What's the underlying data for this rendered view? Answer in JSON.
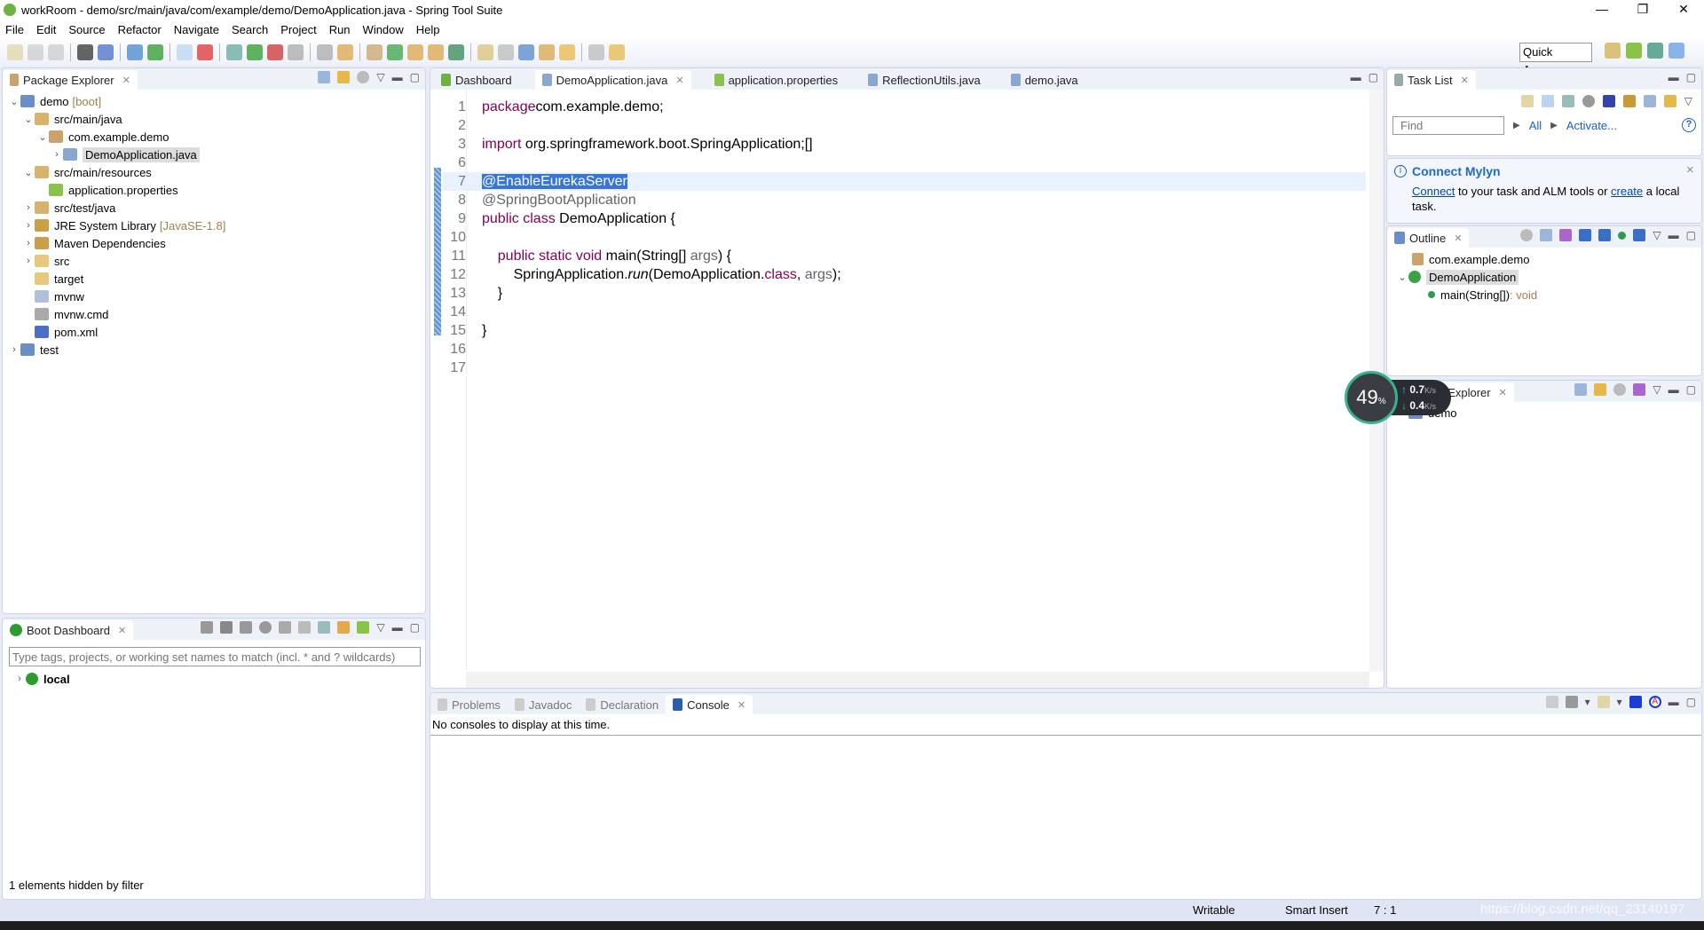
{
  "window": {
    "title": "workRoom - demo/src/main/java/com/example/demo/DemoApplication.java - Spring Tool Suite",
    "min": "—",
    "max": "❐",
    "close": "✕"
  },
  "menu": [
    "File",
    "Edit",
    "Source",
    "Refactor",
    "Navigate",
    "Search",
    "Project",
    "Run",
    "Window",
    "Help"
  ],
  "toolbar": {
    "icons": [
      "new-icon",
      "save-icon",
      "save-all-icon",
      "user-icon",
      "terminal-icon",
      "skip-breakpoints-icon",
      "boot-icon",
      "toggle-icon",
      "spring-relaunch-icon",
      "debug-icon",
      "run-icon",
      "external-tools-icon",
      "stop-icon",
      "open-task-icon",
      "new-java-project-icon",
      "new-package-icon",
      "new-class-icon",
      "open-type-icon",
      "open-folder-icon",
      "search-icon",
      "annotation-icon",
      "highlight-icon",
      "show-whitespace-icon",
      "next-annotation-icon",
      "prev-annotation-icon",
      "back-icon",
      "forward-icon"
    ],
    "quick_access": "Quick Access"
  },
  "package_explorer": {
    "title": "Package Explorer",
    "items": [
      {
        "label": "demo",
        "deco": "[boot]",
        "indent": 0,
        "arrow": "⌄",
        "icon": "project-icon"
      },
      {
        "label": "src/main/java",
        "indent": 1,
        "arrow": "⌄",
        "icon": "source-folder-icon"
      },
      {
        "label": "com.example.demo",
        "indent": 2,
        "arrow": "⌄",
        "icon": "package-icon"
      },
      {
        "label": "DemoApplication.java",
        "indent": 3,
        "arrow": "›",
        "icon": "java-file-icon",
        "selected": true
      },
      {
        "label": "src/main/resources",
        "indent": 1,
        "arrow": "⌄",
        "icon": "source-folder-icon"
      },
      {
        "label": "application.properties",
        "indent": 2,
        "arrow": "",
        "icon": "spring-leaf-icon"
      },
      {
        "label": "src/test/java",
        "indent": 1,
        "arrow": "›",
        "icon": "source-folder-icon"
      },
      {
        "label": "JRE System Library",
        "deco": "[JavaSE-1.8]",
        "indent": 1,
        "arrow": "›",
        "icon": "library-icon"
      },
      {
        "label": "Maven Dependencies",
        "indent": 1,
        "arrow": "›",
        "icon": "library-icon"
      },
      {
        "label": "src",
        "indent": 1,
        "arrow": "›",
        "icon": "folder-icon"
      },
      {
        "label": "target",
        "indent": 1,
        "arrow": "",
        "icon": "folder-icon"
      },
      {
        "label": "mvnw",
        "indent": 1,
        "arrow": "",
        "icon": "text-file-icon"
      },
      {
        "label": "mvnw.cmd",
        "indent": 1,
        "arrow": "",
        "icon": "cmd-file-icon"
      },
      {
        "label": "pom.xml",
        "indent": 1,
        "arrow": "",
        "icon": "maven-file-icon"
      },
      {
        "label": "test",
        "indent": 0,
        "arrow": "›",
        "icon": "project-icon"
      }
    ]
  },
  "boot_dashboard": {
    "title": "Boot Dashboard",
    "filter_placeholder": "Type tags, projects, or working set names to match (incl. * and ? wildcards)",
    "local": "local",
    "footer": "1 elements hidden by filter"
  },
  "editor": {
    "tabs": [
      "Dashboard",
      "DemoApplication.java",
      "application.properties",
      "ReflectionUtils.java",
      "demo.java"
    ],
    "active_tab": 1,
    "lines": [
      {
        "n": "1",
        "html": [
          [
            "kw",
            "package"
          ],
          [
            "",
            "com.example.demo;"
          ]
        ]
      },
      {
        "n": "2",
        "html": []
      },
      {
        "n": "3",
        "html": [
          [
            "kw",
            "import"
          ],
          [
            "",
            " org.springframework.boot.SpringApplication;"
          ],
          [
            "",
            "[]"
          ]
        ]
      },
      {
        "n": "6",
        "html": []
      },
      {
        "n": "7",
        "html": [
          [
            "sel",
            "@EnableEurekaServer"
          ]
        ]
      },
      {
        "n": "8",
        "html": [
          [
            "ann",
            "@SpringBootApplication"
          ]
        ]
      },
      {
        "n": "9",
        "html": [
          [
            "kw",
            "public class"
          ],
          [
            "",
            " DemoApplication {"
          ]
        ]
      },
      {
        "n": "10",
        "html": []
      },
      {
        "n": "11",
        "html": [
          [
            "",
            "    "
          ],
          [
            "kw",
            "public static void"
          ],
          [
            "",
            " main(String[] "
          ],
          [
            "ann",
            "args"
          ],
          [
            "",
            ") {"
          ]
        ]
      },
      {
        "n": "12",
        "html": [
          [
            "",
            "        SpringApplication."
          ],
          [
            "it",
            "run"
          ],
          [
            "",
            "(DemoApplication."
          ],
          [
            "kw",
            "class"
          ],
          [
            "",
            ", "
          ],
          [
            "ann",
            "args"
          ],
          [
            "",
            ");"
          ]
        ]
      },
      {
        "n": "13",
        "html": [
          [
            "",
            "    }"
          ]
        ]
      },
      {
        "n": "14",
        "html": []
      },
      {
        "n": "15",
        "html": [
          [
            "",
            "}"
          ]
        ]
      },
      {
        "n": "16",
        "html": []
      },
      {
        "n": "17",
        "html": []
      }
    ]
  },
  "task_list": {
    "title": "Task List",
    "find_placeholder": "Find",
    "all": "All",
    "activate": "Activate..."
  },
  "mylyn": {
    "title": "Connect Mylyn",
    "connect": "Connect",
    "text1": " to your task and ALM tools or ",
    "create": "create",
    "text2": " a local task."
  },
  "outline": {
    "title": "Outline",
    "package": "com.example.demo",
    "class": "DemoApplication",
    "method": "main(String[])",
    "method_type": " : void"
  },
  "spring_explorer": {
    "title": "Spring Explorer",
    "item": "demo"
  },
  "console": {
    "tabs": [
      "Problems",
      "Javadoc",
      "Declaration",
      "Console"
    ],
    "message": "No consoles to display at this time."
  },
  "status": {
    "writable": "Writable",
    "insert": "Smart Insert",
    "position": "7 : 1",
    "watermark": "https://blog.csdn.net/qq_23140197"
  },
  "net_widget": {
    "percent": "49",
    "unit": "%",
    "up": "0.7",
    "down": "0.4",
    "rate_unit": "K/s"
  }
}
